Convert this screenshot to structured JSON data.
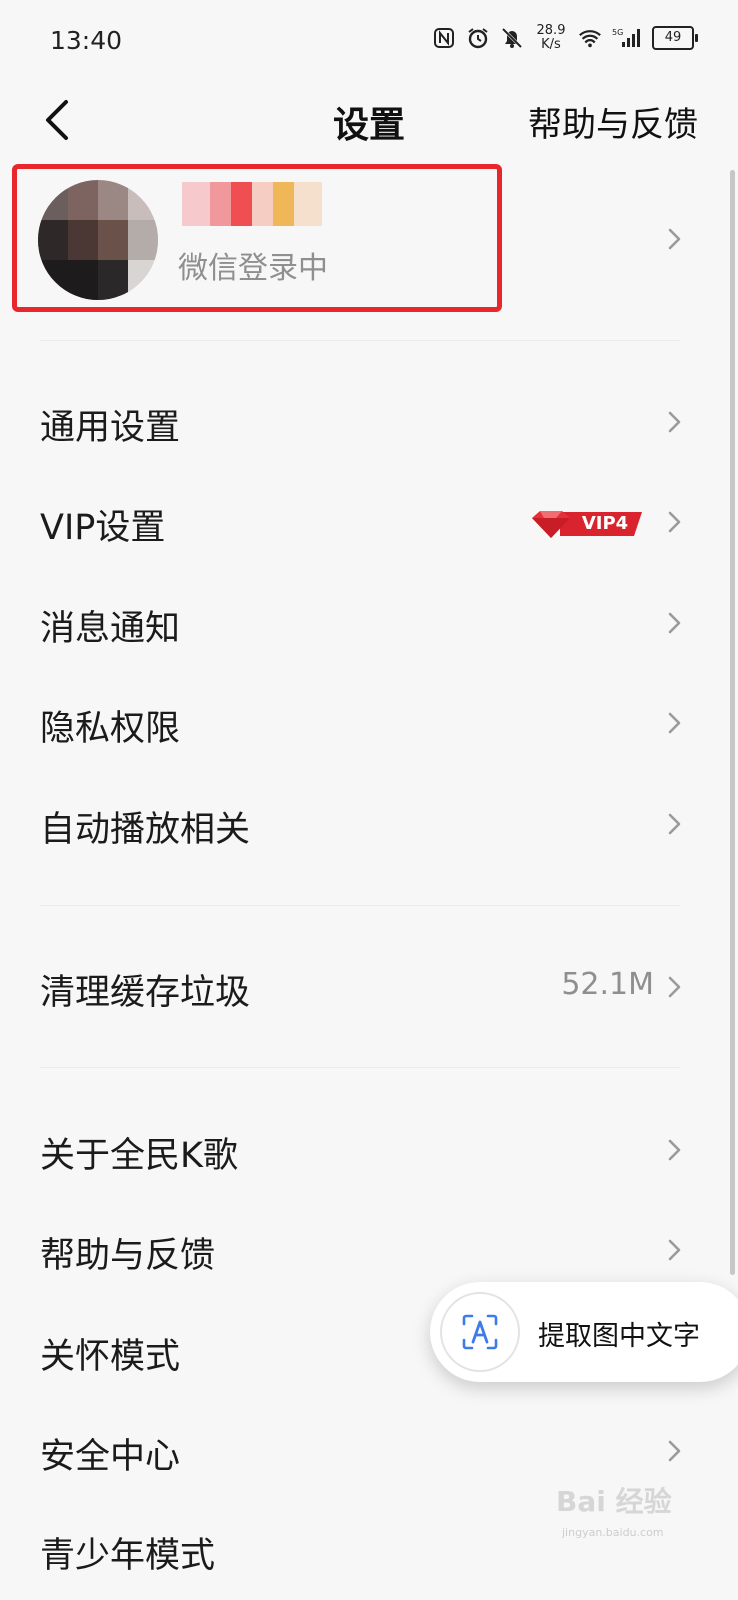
{
  "status_bar": {
    "time": "13:40",
    "net_speed_value": "28.9",
    "net_speed_unit": "K/s",
    "battery": "49"
  },
  "header": {
    "title": "设置",
    "help_link": "帮助与反馈"
  },
  "profile": {
    "login_status": "微信登录中"
  },
  "menu": {
    "general": "通用设置",
    "vip": "VIP设置",
    "vip_badge": "VIP4",
    "notifications": "消息通知",
    "privacy": "隐私权限",
    "autoplay": "自动播放相关",
    "clear_cache": "清理缓存垃圾",
    "cache_size": "52.1M",
    "about": "关于全民K歌",
    "help": "帮助与反馈",
    "care_mode": "关怀模式",
    "security": "安全中心",
    "teen_mode": "青少年模式"
  },
  "ocr_popup": {
    "label": "提取图中文字"
  },
  "watermark": {
    "brand": "Bai 经验",
    "url": "jingyan.baidu.com"
  },
  "colors": {
    "highlight_border": "#e7272b",
    "vip_red": "#d9232d",
    "secondary_text": "#8f8f8f",
    "ocr_blue": "#3d7be8"
  }
}
